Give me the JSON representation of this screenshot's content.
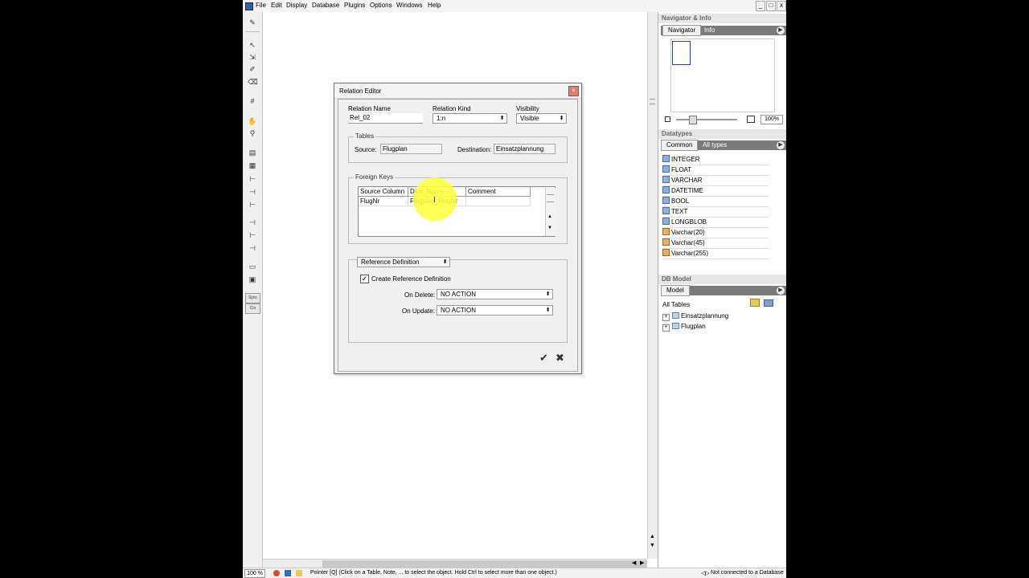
{
  "menu": [
    "File",
    "Edit",
    "Display",
    "Database",
    "Plugins",
    "Options",
    "Windows",
    "Help"
  ],
  "window_buttons": {
    "minimize": "_",
    "restore": "□",
    "close": "x"
  },
  "toolbar": {
    "sync": "Sync",
    "create": "Crs"
  },
  "dialog": {
    "title": "Relation Editor",
    "relation_name_label": "Relation Name",
    "relation_name_value": "Rel_02",
    "relation_kind_label": "Relation Kind",
    "relation_kind_value": "1:n",
    "visibility_label": "Visibility",
    "visibility_value": "Visible",
    "tables_group": "Tables",
    "source_label": "Source:",
    "source_value": "Flugplan",
    "destination_label": "Destination:",
    "destination_value": "Einsatzplannung",
    "foreign_keys_group": "Foreign Keys",
    "fk_columns": [
      "Source Column",
      "Dest. Name",
      "Comment"
    ],
    "fk_rows": [
      [
        "FlugNr",
        "Flugplan_FlugNr",
        ""
      ]
    ],
    "ref_dropdown": "Reference Definition",
    "create_ref_label": "Create Reference Definition",
    "create_ref_checked": true,
    "on_delete_label": "On Delete:",
    "on_delete_value": "NO ACTION",
    "on_update_label": "On Update:",
    "on_update_value": "NO ACTION"
  },
  "navigator": {
    "title": "Navigator & Info",
    "tabs": [
      "Navigator",
      "Info"
    ],
    "zoom": "100%"
  },
  "datatypes": {
    "title": "Datatypes",
    "tabs": [
      "Common",
      "All types"
    ],
    "items": [
      "INTEGER",
      "FLOAT",
      "VARCHAR",
      "DATETIME",
      "BOOL",
      "TEXT",
      "LONGBLOB",
      "Varchar(20)",
      "Varchar(45)",
      "Varchar(255)"
    ]
  },
  "dbmodel": {
    "title": "DB Model",
    "tab": "Model",
    "all_tables": "All Tables",
    "tables": [
      "Einsatzplannung",
      "Flugplan"
    ]
  },
  "status": {
    "zoom": "100 %",
    "message": "Pointer [Q] (Click on a Table, Note, ... to select the object. Hold Ctrl to select more than one object.)",
    "connection": "Not connected to a Database"
  },
  "colors": {
    "highlight": "#ffff3c",
    "panel_tab_bar": "#7b7b7b"
  }
}
